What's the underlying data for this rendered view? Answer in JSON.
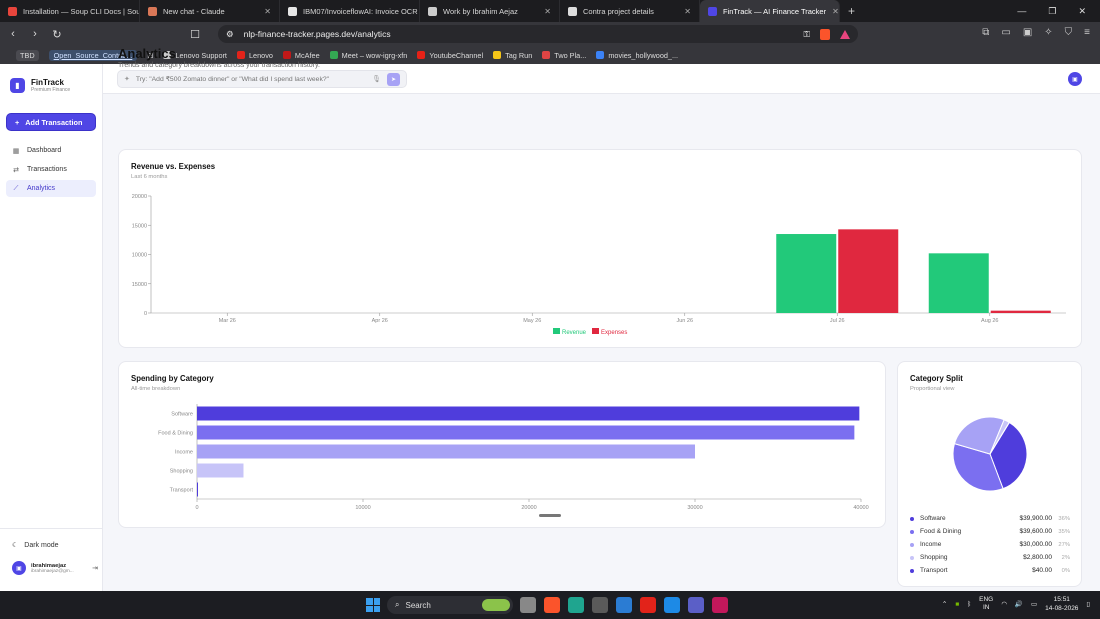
{
  "browser": {
    "tabs": [
      {
        "title": "Installation — Soup CLI Docs | Soup",
        "color": "#e8453c",
        "active": false
      },
      {
        "title": "New chat - Claude",
        "color": "#d97757",
        "active": false
      },
      {
        "title": "IBM07/InvoiceflowAI: Invoice OCR o",
        "color": "#e6e6e6",
        "active": false
      },
      {
        "title": "Work by Ibrahim Aejaz",
        "color": "#cccccc",
        "active": false
      },
      {
        "title": "Contra project details",
        "color": "#dddddd",
        "active": false
      },
      {
        "title": "FinTrack — AI Finance Tracker",
        "color": "#4f46e5",
        "active": true
      }
    ],
    "url": "nlp-finance-tracker.pages.dev/analytics",
    "bookmarks": [
      {
        "label": "TBD",
        "kind": "pill",
        "color": ""
      },
      {
        "label": "Open_Source_Contrib...",
        "kind": "link",
        "color": ""
      },
      {
        "label": "Lenovo Support",
        "kind": "normal",
        "color": "#cccccc"
      },
      {
        "label": "Lenovo",
        "kind": "normal",
        "color": "#e2231a"
      },
      {
        "label": "McAfee",
        "kind": "normal",
        "color": "#c01818"
      },
      {
        "label": "Meet – wow-igrg-xfn",
        "kind": "normal",
        "color": "#34a853"
      },
      {
        "label": "YoutubeChannel",
        "kind": "normal",
        "color": "#e62117"
      },
      {
        "label": "Tag Run",
        "kind": "normal",
        "color": "#f5c518"
      },
      {
        "label": "Two Pla...",
        "kind": "normal",
        "color": "#d44"
      },
      {
        "label": "movies_hollywood_...",
        "kind": "normal",
        "color": "#3b82f6"
      }
    ]
  },
  "sidebar": {
    "brand_name": "FinTrack",
    "brand_sub": "Premium Finance",
    "add_label": "Add Transaction",
    "items": [
      {
        "label": "Dashboard",
        "icon": "grid-icon",
        "active": false
      },
      {
        "label": "Transactions",
        "icon": "swap-icon",
        "active": false
      },
      {
        "label": "Analytics",
        "icon": "chart-icon",
        "active": true
      }
    ],
    "dark_mode": "Dark mode",
    "user_name": "ibrahimaejaz",
    "user_email": "ibrahimaejaz@gm..."
  },
  "search": {
    "placeholder": "Try: \"Add ₹500 Zomato dinner\" or \"What did I spend last week?\""
  },
  "page": {
    "title": "Analytics",
    "subtitle": "Trends and category breakdowns across your transaction history."
  },
  "revenue_card": {
    "title": "Revenue vs. Expenses",
    "subtitle": "Last 6 months"
  },
  "spending_card": {
    "title": "Spending by Category",
    "subtitle": "All-time breakdown"
  },
  "split_card": {
    "title": "Category Split",
    "subtitle": "Proportional view"
  },
  "colors": {
    "revenue": "#22c97a",
    "expenses": "#e0283f",
    "accent": "#4f46e5"
  },
  "chart_data": [
    {
      "type": "bar",
      "title": "Revenue vs. Expenses",
      "subtitle": "Last 6 months",
      "categories": [
        "Mar 26",
        "Apr 26",
        "May 26",
        "Jun 26",
        "Jul 26",
        "Aug 26"
      ],
      "series": [
        {
          "name": "Revenue",
          "values": [
            0,
            0,
            0,
            0,
            13500,
            10200
          ],
          "color": "#22c97a"
        },
        {
          "name": "Expenses",
          "values": [
            0,
            0,
            0,
            0,
            14300,
            400
          ],
          "color": "#e0283f"
        }
      ],
      "yticks": [
        "20000",
        "15000",
        "10000",
        "15000",
        "0"
      ],
      "ylim": [
        0,
        20000
      ],
      "legend": "bottom-center"
    },
    {
      "type": "bar",
      "orientation": "horizontal",
      "title": "Spending by Category",
      "subtitle": "All-time breakdown",
      "categories": [
        "Software",
        "Food & Dining",
        "Income",
        "Shopping",
        "Transport"
      ],
      "values": [
        39900,
        39600,
        30000,
        2800,
        40
      ],
      "colors": [
        "#4f3ddc",
        "#7b6ff0",
        "#a7a2f5",
        "#c7c4f8",
        "#4f3ddc"
      ],
      "xticks": [
        "0",
        "10000",
        "20000",
        "30000",
        "40000"
      ],
      "xlim": [
        0,
        40000
      ]
    },
    {
      "type": "pie",
      "title": "Category Split",
      "subtitle": "Proportional view",
      "labels": [
        "Software",
        "Food & Dining",
        "Income",
        "Shopping",
        "Transport"
      ],
      "values": [
        39900,
        39600,
        30000,
        2800,
        40
      ],
      "amounts": [
        "$39,900.00",
        "$39,600.00",
        "$30,000.00",
        "$2,800.00",
        "$40.00"
      ],
      "percents": [
        "36%",
        "35%",
        "27%",
        "2%",
        "0%"
      ],
      "colors": [
        "#4f3ddc",
        "#7b6ff0",
        "#a7a2f5",
        "#c7c4f8",
        "#4f3ddc"
      ]
    }
  ],
  "taskbar": {
    "search_label": "Search",
    "lang": "ENG",
    "region": "IN",
    "time": "15:51",
    "date": "14-08-2026"
  }
}
